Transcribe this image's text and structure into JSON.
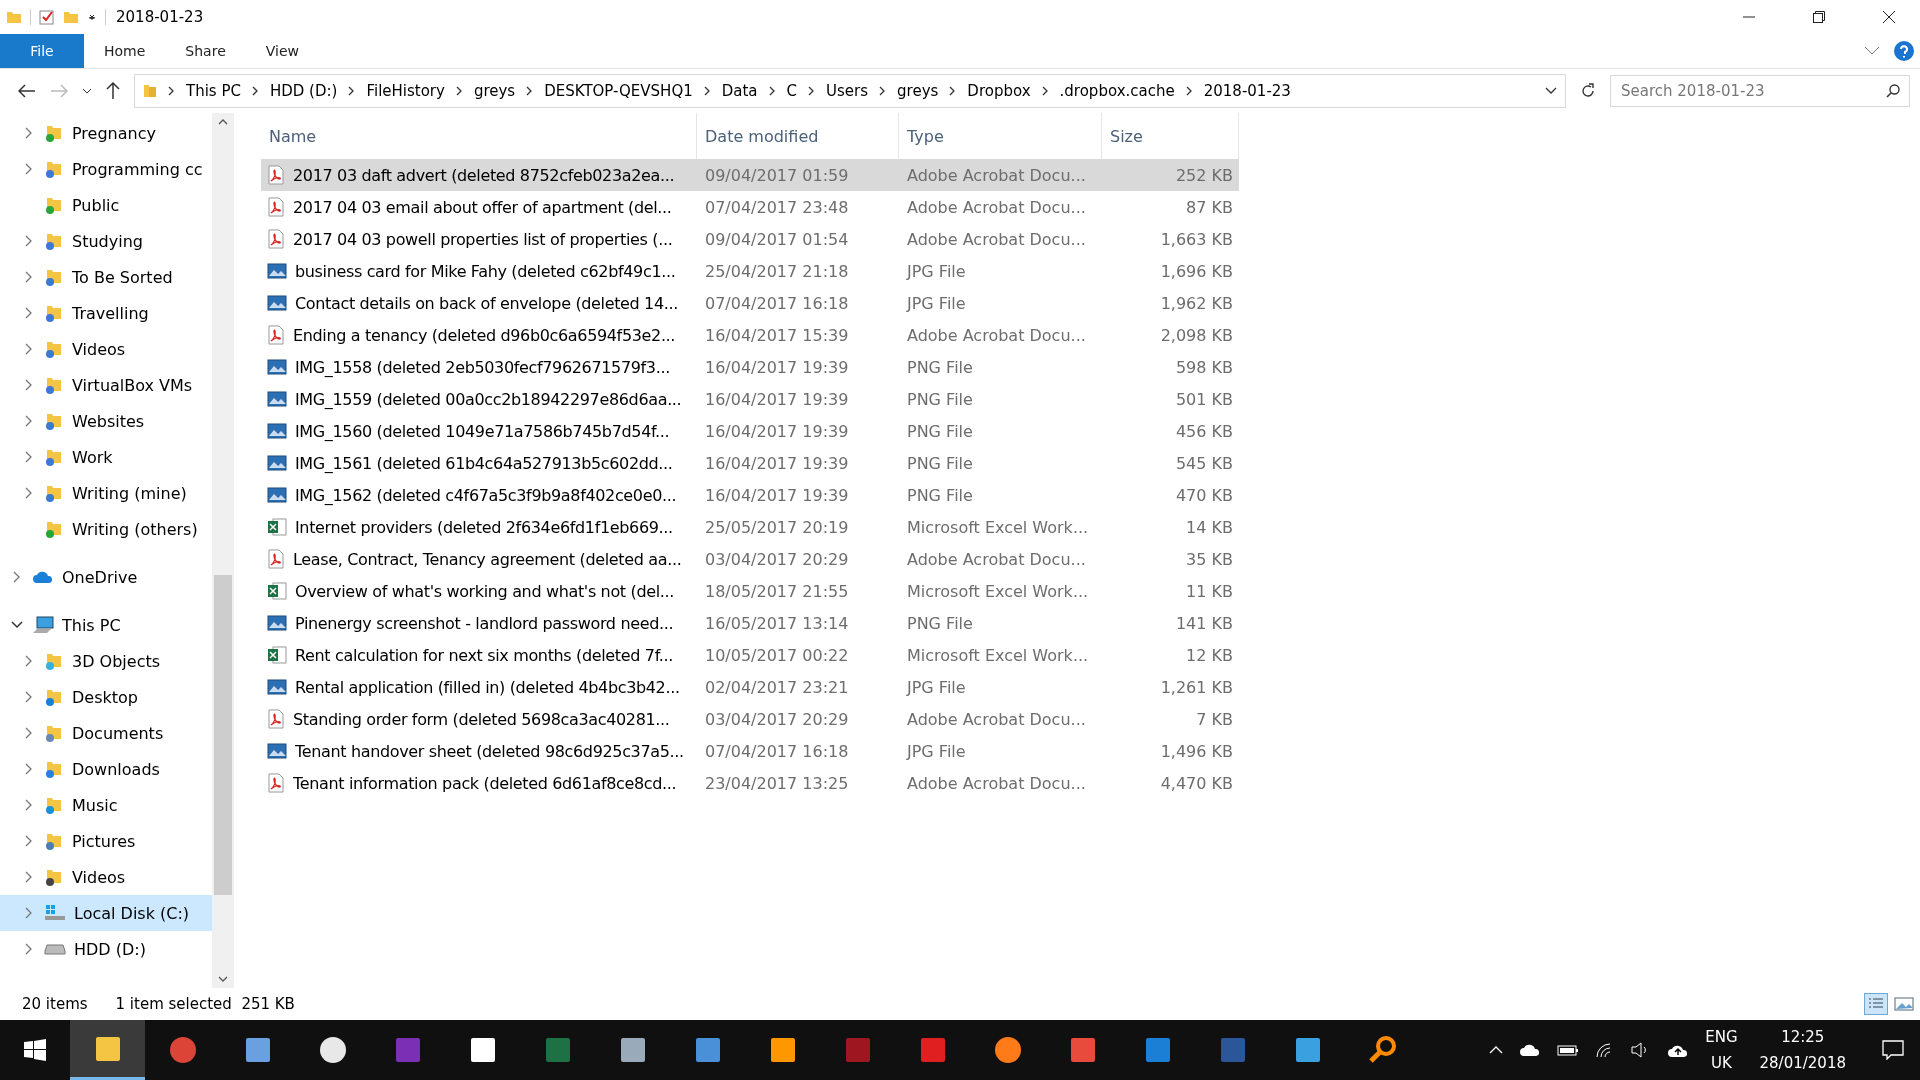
{
  "window": {
    "title": "2018-01-23"
  },
  "ribbon_tabs": [
    {
      "label": "File",
      "kind": "menu",
      "selected": false
    },
    {
      "label": "Home",
      "kind": "tab",
      "selected": false
    },
    {
      "label": "Share",
      "kind": "tab",
      "selected": false
    },
    {
      "label": "View",
      "kind": "tab",
      "selected": false
    }
  ],
  "address_bar": {
    "crumbs": [
      "This PC",
      "HDD (D:)",
      "FileHistory",
      "greys",
      "DESKTOP-QEVSHQ1",
      "Data",
      "C",
      "Users",
      "greys",
      "Dropbox",
      ".dropbox.cache",
      "2018-01-23"
    ]
  },
  "search": {
    "placeholder": "Search 2018-01-23"
  },
  "sidebar": {
    "items": [
      {
        "label": "Pregnancy",
        "kind": "folder-synced",
        "expandable": true,
        "expanded": false,
        "selected": false
      },
      {
        "label": "Programming cc",
        "kind": "folder-syncing",
        "expandable": true,
        "expanded": false,
        "selected": false
      },
      {
        "label": "Public",
        "kind": "folder-synced",
        "expandable": false,
        "selected": false
      },
      {
        "label": "Studying",
        "kind": "folder-syncing",
        "expandable": true,
        "expanded": false,
        "selected": false
      },
      {
        "label": "To Be Sorted",
        "kind": "folder-syncing",
        "expandable": true,
        "expanded": false,
        "selected": false
      },
      {
        "label": "Travelling",
        "kind": "folder-syncing",
        "expandable": true,
        "expanded": false,
        "selected": false
      },
      {
        "label": "Videos",
        "kind": "folder-syncing",
        "expandable": true,
        "expanded": false,
        "selected": false
      },
      {
        "label": "VirtualBox VMs",
        "kind": "folder-syncing",
        "expandable": true,
        "expanded": false,
        "selected": false
      },
      {
        "label": "Websites",
        "kind": "folder-syncing",
        "expandable": true,
        "expanded": false,
        "selected": false
      },
      {
        "label": "Work",
        "kind": "folder-syncing",
        "expandable": true,
        "expanded": false,
        "selected": false
      },
      {
        "label": "Writing (mine)",
        "kind": "folder-syncing",
        "expandable": true,
        "expanded": false,
        "selected": false
      },
      {
        "label": "Writing (others)",
        "kind": "folder-synced",
        "expandable": false,
        "selected": false
      },
      {
        "label": "OneDrive",
        "kind": "cloud",
        "expandable": true,
        "expanded": false,
        "selected": false
      },
      {
        "label": "This PC",
        "kind": "computer",
        "expandable": true,
        "expanded": true,
        "selected": false
      },
      {
        "label": "3D Objects",
        "kind": "folder-3d",
        "expandable": true,
        "expanded": false,
        "selected": false
      },
      {
        "label": "Desktop",
        "kind": "folder-desktop",
        "expandable": true,
        "expanded": false,
        "selected": false
      },
      {
        "label": "Documents",
        "kind": "folder-documents",
        "expandable": true,
        "expanded": false,
        "selected": false
      },
      {
        "label": "Downloads",
        "kind": "folder-downloads",
        "expandable": true,
        "expanded": false,
        "selected": false
      },
      {
        "label": "Music",
        "kind": "folder-music",
        "expandable": true,
        "expanded": false,
        "selected": false
      },
      {
        "label": "Pictures",
        "kind": "folder-pictures",
        "expandable": true,
        "expanded": false,
        "selected": false
      },
      {
        "label": "Videos",
        "kind": "folder-videos",
        "expandable": true,
        "expanded": false,
        "selected": false
      },
      {
        "label": "Local Disk (C:)",
        "kind": "drive-windows",
        "expandable": true,
        "expanded": false,
        "selected": true
      },
      {
        "label": "HDD (D:)",
        "kind": "drive",
        "expandable": true,
        "expanded": false,
        "selected": false
      }
    ]
  },
  "table": {
    "columns": [
      "Name",
      "Date modified",
      "Type",
      "Size"
    ],
    "rows": [
      {
        "kind": "pdf",
        "name": "2017 03 daft advert (deleted 8752cfeb023a2ea...",
        "date": "09/04/2017 01:59",
        "type": "Adobe Acrobat Docu...",
        "size": "252 KB",
        "selected": true
      },
      {
        "kind": "pdf",
        "name": "2017 04 03 email about offer of apartment (del...",
        "date": "07/04/2017 23:48",
        "type": "Adobe Acrobat Docu...",
        "size": "87 KB",
        "selected": false
      },
      {
        "kind": "pdf",
        "name": "2017 04 03 powell properties list of properties (...",
        "date": "09/04/2017 01:54",
        "type": "Adobe Acrobat Docu...",
        "size": "1,663 KB",
        "selected": false
      },
      {
        "kind": "image",
        "name": "business card for Mike Fahy (deleted c62bf49c1...",
        "date": "25/04/2017 21:18",
        "type": "JPG File",
        "size": "1,696 KB",
        "selected": false
      },
      {
        "kind": "image",
        "name": "Contact details on back of envelope (deleted 14...",
        "date": "07/04/2017 16:18",
        "type": "JPG File",
        "size": "1,962 KB",
        "selected": false
      },
      {
        "kind": "pdf",
        "name": "Ending a tenancy (deleted d96b0c6a6594f53e2...",
        "date": "16/04/2017 15:39",
        "type": "Adobe Acrobat Docu...",
        "size": "2,098 KB",
        "selected": false
      },
      {
        "kind": "image",
        "name": "IMG_1558 (deleted 2eb5030fecf7962671579f3...",
        "date": "16/04/2017 19:39",
        "type": "PNG File",
        "size": "598 KB",
        "selected": false
      },
      {
        "kind": "image",
        "name": "IMG_1559 (deleted 00a0cc2b18942297e86d6aa...",
        "date": "16/04/2017 19:39",
        "type": "PNG File",
        "size": "501 KB",
        "selected": false
      },
      {
        "kind": "image",
        "name": "IMG_1560 (deleted 1049e71a7586b745b7d54f...",
        "date": "16/04/2017 19:39",
        "type": "PNG File",
        "size": "456 KB",
        "selected": false
      },
      {
        "kind": "image",
        "name": "IMG_1561 (deleted 61b4c64a527913b5c602dd...",
        "date": "16/04/2017 19:39",
        "type": "PNG File",
        "size": "545 KB",
        "selected": false
      },
      {
        "kind": "image",
        "name": "IMG_1562 (deleted c4f67a5c3f9b9a8f402ce0e0...",
        "date": "16/04/2017 19:39",
        "type": "PNG File",
        "size": "470 KB",
        "selected": false
      },
      {
        "kind": "excel",
        "name": "Internet providers (deleted 2f634e6fd1f1eb669...",
        "date": "25/05/2017 20:19",
        "type": "Microsoft Excel Work...",
        "size": "14 KB",
        "selected": false
      },
      {
        "kind": "pdf",
        "name": "Lease, Contract, Tenancy agreement (deleted aa...",
        "date": "03/04/2017 20:29",
        "type": "Adobe Acrobat Docu...",
        "size": "35 KB",
        "selected": false
      },
      {
        "kind": "excel",
        "name": "Overview of what's working and what's not (del...",
        "date": "18/05/2017 21:55",
        "type": "Microsoft Excel Work...",
        "size": "11 KB",
        "selected": false
      },
      {
        "kind": "image",
        "name": "Pinenergy screenshot - landlord password need...",
        "date": "16/05/2017 13:14",
        "type": "PNG File",
        "size": "141 KB",
        "selected": false
      },
      {
        "kind": "excel",
        "name": "Rent calculation for next six months (deleted 7f...",
        "date": "10/05/2017 00:22",
        "type": "Microsoft Excel Work...",
        "size": "12 KB",
        "selected": false
      },
      {
        "kind": "image",
        "name": "Rental application (filled in) (deleted 4b4bc3b42...",
        "date": "02/04/2017 23:21",
        "type": "JPG File",
        "size": "1,261 KB",
        "selected": false
      },
      {
        "kind": "pdf",
        "name": "Standing order form (deleted 5698ca3ac40281...",
        "date": "03/04/2017 20:29",
        "type": "Adobe Acrobat Docu...",
        "size": "7 KB",
        "selected": false
      },
      {
        "kind": "image",
        "name": "Tenant handover sheet (deleted 98c6d925c37a5...",
        "date": "07/04/2017 16:18",
        "type": "JPG File",
        "size": "1,496 KB",
        "selected": false
      },
      {
        "kind": "pdf",
        "name": "Tenant information pack (deleted 6d61af8ce8cd...",
        "date": "23/04/2017 13:25",
        "type": "Adobe Acrobat Docu...",
        "size": "4,470 KB",
        "selected": false
      }
    ]
  },
  "status_bar": {
    "item_count": "20 items",
    "selection": "1 item selected  251 KB"
  },
  "taskbar": {
    "apps": [
      {
        "kind": "explorer",
        "selected": true
      },
      {
        "kind": "chrome",
        "selected": false
      },
      {
        "kind": "notepad",
        "selected": false
      },
      {
        "kind": "stopwatch",
        "selected": false
      },
      {
        "kind": "onenote",
        "selected": false
      },
      {
        "kind": "calculator",
        "selected": false
      },
      {
        "kind": "excel",
        "selected": false
      },
      {
        "kind": "monitor",
        "selected": false
      },
      {
        "kind": "translate",
        "selected": false
      },
      {
        "kind": "sublime",
        "selected": false
      },
      {
        "kind": "mendeley",
        "selected": false
      },
      {
        "kind": "acrobat",
        "selected": false
      },
      {
        "kind": "firefox",
        "selected": false
      },
      {
        "kind": "bookmark",
        "selected": false
      },
      {
        "kind": "edge",
        "selected": false
      },
      {
        "kind": "word",
        "selected": false
      },
      {
        "kind": "cubes",
        "selected": false
      },
      {
        "kind": "search",
        "selected": false
      }
    ],
    "language": [
      "ENG",
      "UK"
    ],
    "time": "12:25",
    "date": "28/01/2018"
  }
}
